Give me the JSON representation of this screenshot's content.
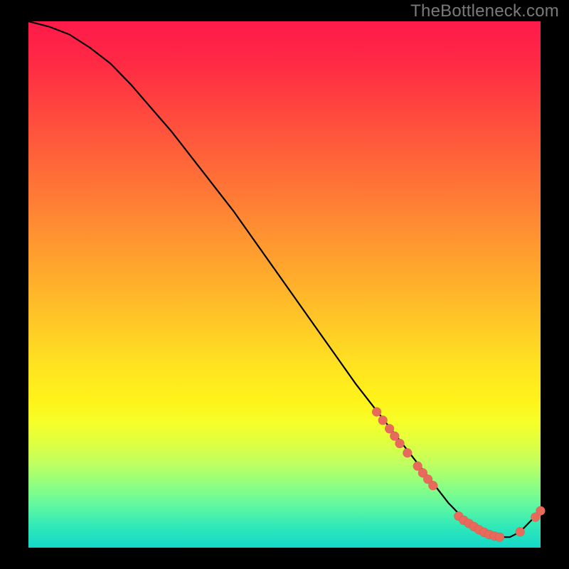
{
  "watermark": "TheBottleneck.com",
  "chart_data": {
    "type": "line",
    "title": "",
    "xlabel": "",
    "ylabel": "",
    "xlim": [
      0,
      100
    ],
    "ylim": [
      0,
      100
    ],
    "grid": false,
    "legend": false,
    "series": [
      {
        "name": "bottleneck-curve",
        "x": [
          0,
          4,
          8,
          12,
          16,
          20,
          24,
          28,
          32,
          36,
          40,
          44,
          48,
          52,
          56,
          60,
          64,
          68,
          72,
          74,
          76,
          78,
          80,
          82,
          84,
          86,
          88,
          90,
          92,
          94,
          96,
          98,
          100
        ],
        "y": [
          100,
          99,
          97.5,
          95,
          92,
          88,
          83.5,
          79,
          74,
          69,
          64,
          58.5,
          53,
          47.5,
          42,
          36.5,
          31,
          26,
          21,
          18.5,
          16,
          13.5,
          11,
          8.5,
          6.5,
          5,
          3.5,
          2.5,
          2,
          2,
          3,
          5,
          7
        ]
      }
    ],
    "markers": [
      {
        "x": 68,
        "y": 25.8
      },
      {
        "x": 69.2,
        "y": 24.2
      },
      {
        "x": 70.5,
        "y": 22.6
      },
      {
        "x": 71.5,
        "y": 21.2
      },
      {
        "x": 72.5,
        "y": 19.8
      },
      {
        "x": 74,
        "y": 18.0
      },
      {
        "x": 76,
        "y": 15.5
      },
      {
        "x": 77,
        "y": 14.2
      },
      {
        "x": 78,
        "y": 13.0
      },
      {
        "x": 79,
        "y": 11.8
      },
      {
        "x": 84,
        "y": 6.0
      },
      {
        "x": 85,
        "y": 5.2
      },
      {
        "x": 86,
        "y": 4.6
      },
      {
        "x": 87,
        "y": 4.0
      },
      {
        "x": 88,
        "y": 3.4
      },
      {
        "x": 89,
        "y": 2.9
      },
      {
        "x": 90,
        "y": 2.5
      },
      {
        "x": 91,
        "y": 2.2
      },
      {
        "x": 92,
        "y": 2.0
      },
      {
        "x": 96,
        "y": 3.0
      },
      {
        "x": 99,
        "y": 5.8
      },
      {
        "x": 100,
        "y": 7.0
      }
    ]
  }
}
